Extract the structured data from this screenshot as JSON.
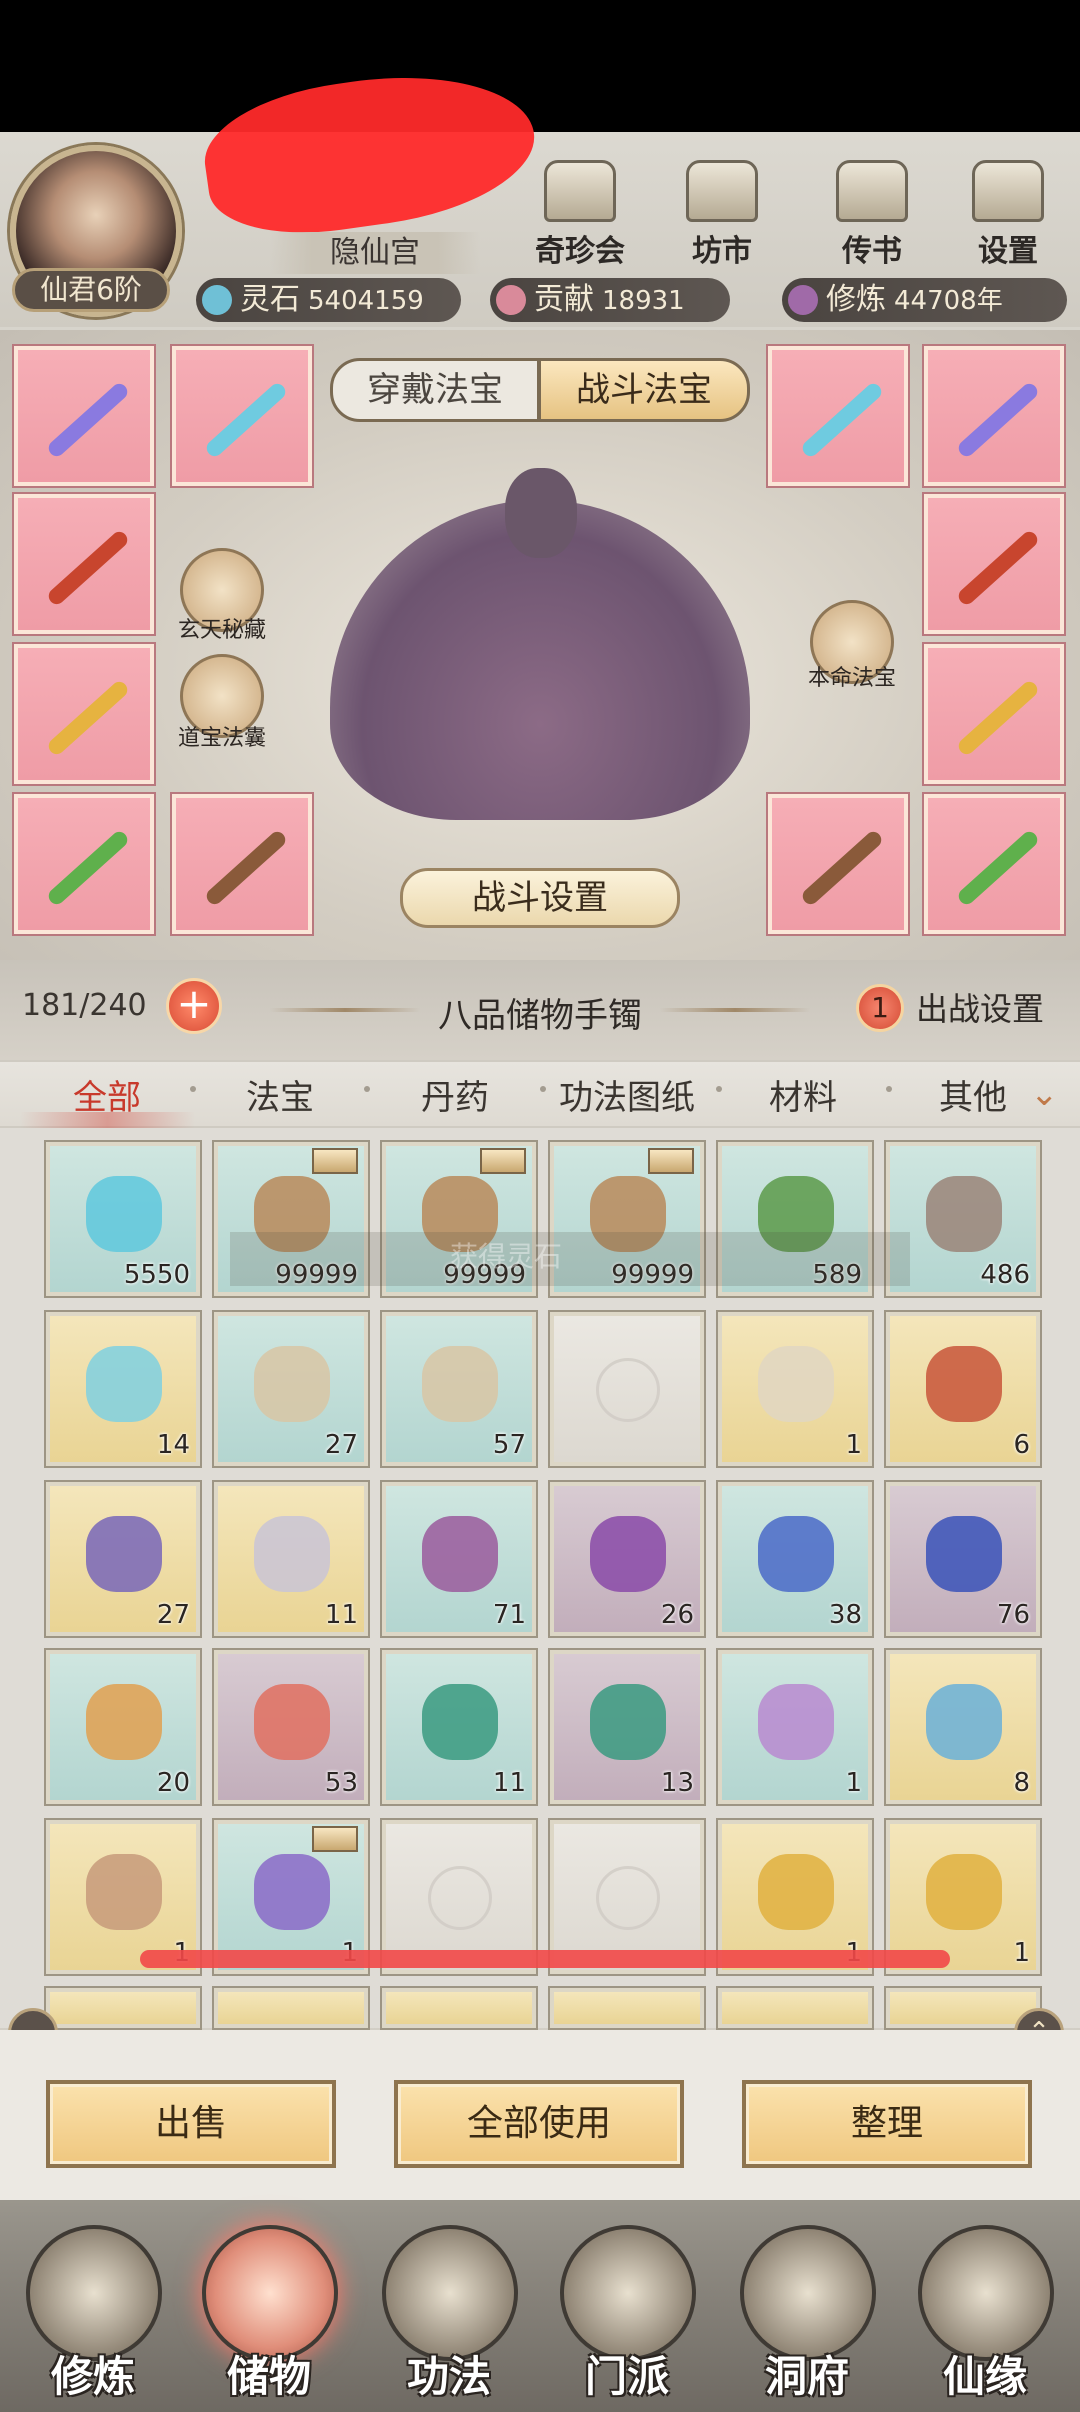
{
  "header": {
    "guild_name": "隐仙宫",
    "rank_badge": "仙君6阶",
    "top_buttons": [
      {
        "label": "奇珍会",
        "icon": "treasure-pavilion-icon"
      },
      {
        "label": "坊市",
        "icon": "market-icon"
      },
      {
        "label": "传书",
        "icon": "scroll-letter-icon"
      },
      {
        "label": "设置",
        "icon": "gear-icon"
      }
    ],
    "resources": [
      {
        "label": "灵石",
        "value": "5404159",
        "color": "#6fc0d6"
      },
      {
        "label": "贡献",
        "value": "18931",
        "color": "#d98a9a"
      },
      {
        "label": "修炼",
        "value": "44708年",
        "color": "#a06aa8"
      }
    ]
  },
  "equipment": {
    "tabs": [
      "穿戴法宝",
      "战斗法宝"
    ],
    "active_tab": "战斗法宝",
    "left_buttons": [
      "玄天秘藏",
      "道宝法囊"
    ],
    "right_button": "本命法宝",
    "battle_settings": "战斗设置"
  },
  "storage": {
    "capacity": "181/240",
    "title": "八品储物手镯",
    "deploy_count": "1",
    "deploy_label": "出战设置"
  },
  "categories": [
    "全部",
    "法宝",
    "丹药",
    "功法图纸",
    "材料",
    "其他"
  ],
  "active_category": "全部",
  "overlay_text": "获得灵石",
  "items": [
    {
      "count": "5550",
      "bg": "c-b",
      "art": "#5ec8dd"
    },
    {
      "count": "99999",
      "bg": "c-b",
      "art": "#b98a5a",
      "tag": true
    },
    {
      "count": "99999",
      "bg": "c-b",
      "art": "#b98a5a",
      "tag": true
    },
    {
      "count": "99999",
      "bg": "c-b",
      "art": "#b98a5a",
      "tag": true
    },
    {
      "count": "589",
      "bg": "c-b",
      "art": "#5c9a4a"
    },
    {
      "count": "486",
      "bg": "c-b",
      "art": "#9a8478"
    },
    {
      "count": "14",
      "bg": "c-y",
      "art": "#7fd0e0"
    },
    {
      "count": "27",
      "bg": "c-b",
      "art": "#d8c6a4"
    },
    {
      "count": "57",
      "bg": "c-b",
      "art": "#d8c6a4"
    },
    {
      "count": "",
      "bg": "c-e",
      "art": "",
      "empty": true
    },
    {
      "count": "1",
      "bg": "c-y",
      "art": "#e0d6c2"
    },
    {
      "count": "6",
      "bg": "c-y",
      "art": "#c8553a"
    },
    {
      "count": "27",
      "bg": "c-y",
      "art": "#7866b8"
    },
    {
      "count": "11",
      "bg": "c-y",
      "art": "#c9c4d6"
    },
    {
      "count": "71",
      "bg": "c-b",
      "art": "#9a5a9c"
    },
    {
      "count": "26",
      "bg": "c-p",
      "art": "#8a4aa8"
    },
    {
      "count": "38",
      "bg": "c-b",
      "art": "#4a6ac8"
    },
    {
      "count": "76",
      "bg": "c-p",
      "art": "#3a52b8"
    },
    {
      "count": "20",
      "bg": "c-b",
      "art": "#e0a050"
    },
    {
      "count": "53",
      "bg": "c-p",
      "art": "#e07060"
    },
    {
      "count": "11",
      "bg": "c-b",
      "art": "#3a9a80"
    },
    {
      "count": "13",
      "bg": "c-p",
      "art": "#3a9a80"
    },
    {
      "count": "1",
      "bg": "c-b",
      "art": "#b88ad0"
    },
    {
      "count": "8",
      "bg": "c-y",
      "art": "#6ab0d8"
    },
    {
      "count": "1",
      "bg": "c-y",
      "art": "#c79a7a"
    },
    {
      "count": "1",
      "bg": "c-b",
      "art": "#8a6ac8",
      "tag": true
    },
    {
      "count": "",
      "bg": "c-e",
      "art": "",
      "empty": true
    },
    {
      "count": "",
      "bg": "c-e",
      "art": "",
      "empty": true
    },
    {
      "count": "1",
      "bg": "c-y",
      "art": "#e0b040"
    },
    {
      "count": "1",
      "bg": "c-y",
      "art": "#e0b040"
    }
  ],
  "actions": [
    "出售",
    "全部使用",
    "整理"
  ],
  "nav": [
    {
      "label": "修炼",
      "icon": "cultivate-icon"
    },
    {
      "label": "储物",
      "icon": "storage-bag-icon",
      "active": true
    },
    {
      "label": "功法",
      "icon": "technique-scroll-icon"
    },
    {
      "label": "门派",
      "icon": "sect-gate-icon"
    },
    {
      "label": "洞府",
      "icon": "cave-dwelling-icon"
    },
    {
      "label": "仙缘",
      "icon": "immortal-fate-icon"
    }
  ]
}
